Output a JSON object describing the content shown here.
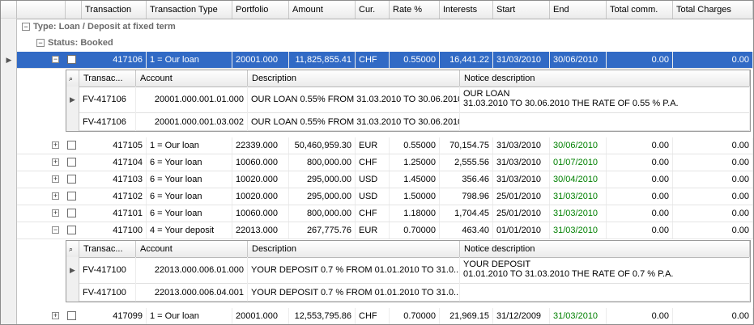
{
  "columns": [
    "Transaction",
    "Transaction Type",
    "Portfolio",
    "Amount",
    "Cur.",
    "Rate %",
    "Interests",
    "Start",
    "End",
    "Total comm.",
    "Total Charges"
  ],
  "group_type": "Type: Loan / Deposit at fixed term",
  "group_status": "Status: Booked",
  "detail_columns": [
    "Transac...",
    "Account",
    "Description",
    "Notice description"
  ],
  "rows": [
    {
      "id": "417106",
      "type": "1 = Our loan",
      "portfolio": "20001.000",
      "amount": "11,825,855.41",
      "cur": "CHF",
      "rate": "0.55000",
      "interests": "16,441.22",
      "start": "31/03/2010",
      "end": "30/06/2010",
      "comm": "0.00",
      "charges": "0.00",
      "expanded": true,
      "selected": true,
      "details": [
        {
          "trans": "FV-417106",
          "account": "20001.000.001.01.000",
          "desc": "OUR LOAN 0.55% FROM 31.03.2010 TO 30.06.2010",
          "notice1": "OUR LOAN",
          "notice2": "31.03.2010 TO 30.06.2010 THE RATE OF 0.55 % P.A."
        },
        {
          "trans": "FV-417106",
          "account": "20001.000.001.03.002",
          "desc": "OUR LOAN 0.55% FROM 31.03.2010 TO 30.06.2010",
          "notice1": "",
          "notice2": ""
        }
      ]
    },
    {
      "id": "417105",
      "type": "1 = Our loan",
      "portfolio": "22339.000",
      "amount": "50,460,959.30",
      "cur": "EUR",
      "rate": "0.55000",
      "interests": "70,154.75",
      "start": "31/03/2010",
      "end": "30/06/2010",
      "comm": "0.00",
      "charges": "0.00"
    },
    {
      "id": "417104",
      "type": "6 = Your loan",
      "portfolio": "10060.000",
      "amount": "800,000.00",
      "cur": "CHF",
      "rate": "1.25000",
      "interests": "2,555.56",
      "start": "31/03/2010",
      "end": "01/07/2010",
      "comm": "0.00",
      "charges": "0.00"
    },
    {
      "id": "417103",
      "type": "6 = Your loan",
      "portfolio": "10020.000",
      "amount": "295,000.00",
      "cur": "USD",
      "rate": "1.45000",
      "interests": "356.46",
      "start": "31/03/2010",
      "end": "30/04/2010",
      "comm": "0.00",
      "charges": "0.00"
    },
    {
      "id": "417102",
      "type": "6 = Your loan",
      "portfolio": "10020.000",
      "amount": "295,000.00",
      "cur": "USD",
      "rate": "1.50000",
      "interests": "798.96",
      "start": "25/01/2010",
      "end": "31/03/2010",
      "comm": "0.00",
      "charges": "0.00"
    },
    {
      "id": "417101",
      "type": "6 = Your loan",
      "portfolio": "10060.000",
      "amount": "800,000.00",
      "cur": "CHF",
      "rate": "1.18000",
      "interests": "1,704.45",
      "start": "25/01/2010",
      "end": "31/03/2010",
      "comm": "0.00",
      "charges": "0.00"
    },
    {
      "id": "417100",
      "type": "4 = Your deposit",
      "portfolio": "22013.000",
      "amount": "267,775.76",
      "cur": "EUR",
      "rate": "0.70000",
      "interests": "463.40",
      "start": "01/01/2010",
      "end": "31/03/2010",
      "comm": "0.00",
      "charges": "0.00",
      "expanded": true,
      "details": [
        {
          "trans": "FV-417100",
          "account": "22013.000.006.01.000",
          "desc": "YOUR DEPOSIT 0.7 % FROM 01.01.2010 TO 31.0...",
          "notice1": "YOUR DEPOSIT",
          "notice2": "01.01.2010 TO 31.03.2010 THE RATE OF 0.7 % P.A."
        },
        {
          "trans": "FV-417100",
          "account": "22013.000.006.04.001",
          "desc": "YOUR DEPOSIT 0.7 % FROM 01.01.2010 TO 31.0...",
          "notice1": "",
          "notice2": ""
        }
      ]
    },
    {
      "id": "417099",
      "type": "1 = Our loan",
      "portfolio": "20001.000",
      "amount": "12,553,795.86",
      "cur": "CHF",
      "rate": "0.70000",
      "interests": "21,969.15",
      "start": "31/12/2009",
      "end": "31/03/2010",
      "comm": "0.00",
      "charges": "0.00"
    }
  ],
  "icons": {
    "expand": "plus-box",
    "collapse": "minus-box",
    "row_indicator": "triangle-right",
    "magnifier": "magnifier"
  }
}
